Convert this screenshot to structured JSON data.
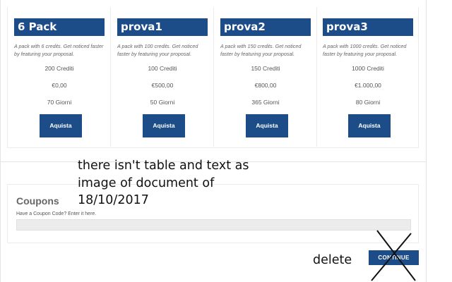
{
  "packs": [
    {
      "title": "6 Pack",
      "description": "A pack with 6 credits. Get noticed faster by featuring your proposal.",
      "credits": "200 Crediti",
      "price": "€0,00",
      "days": "70 Giorni",
      "button": "Aquista"
    },
    {
      "title": "prova1",
      "description": "A pack with 100 credits. Get noticed faster by featuring your proposal.",
      "credits": "100 Crediti",
      "price": "€500,00",
      "days": "50 Giorni",
      "button": "Aquista"
    },
    {
      "title": "prova2",
      "description": "A pack with 150 credits. Get noticed faster by featuring your proposal.",
      "credits": "150 Crediti",
      "price": "€800,00",
      "days": "365 Giorni",
      "button": "Aquista"
    },
    {
      "title": "prova3",
      "description": "A pack with 1000 credits. Get noticed faster by featuring your proposal.",
      "credits": "1000 Crediti",
      "price": "€1.000,00",
      "days": "80 Giorni",
      "button": "Aquista"
    }
  ],
  "coupons": {
    "title": "Coupons",
    "help": "Have a Coupon Code? Enter it here.",
    "value": "",
    "placeholder": ""
  },
  "continue": {
    "label": "CONTINUE"
  },
  "annotations": {
    "note": "there isn't table and text as image of document of 18/10/2017",
    "delete": "delete"
  },
  "colors": {
    "accent": "#1d4d89",
    "input_bg": "#ececec",
    "ink": "#111111"
  }
}
